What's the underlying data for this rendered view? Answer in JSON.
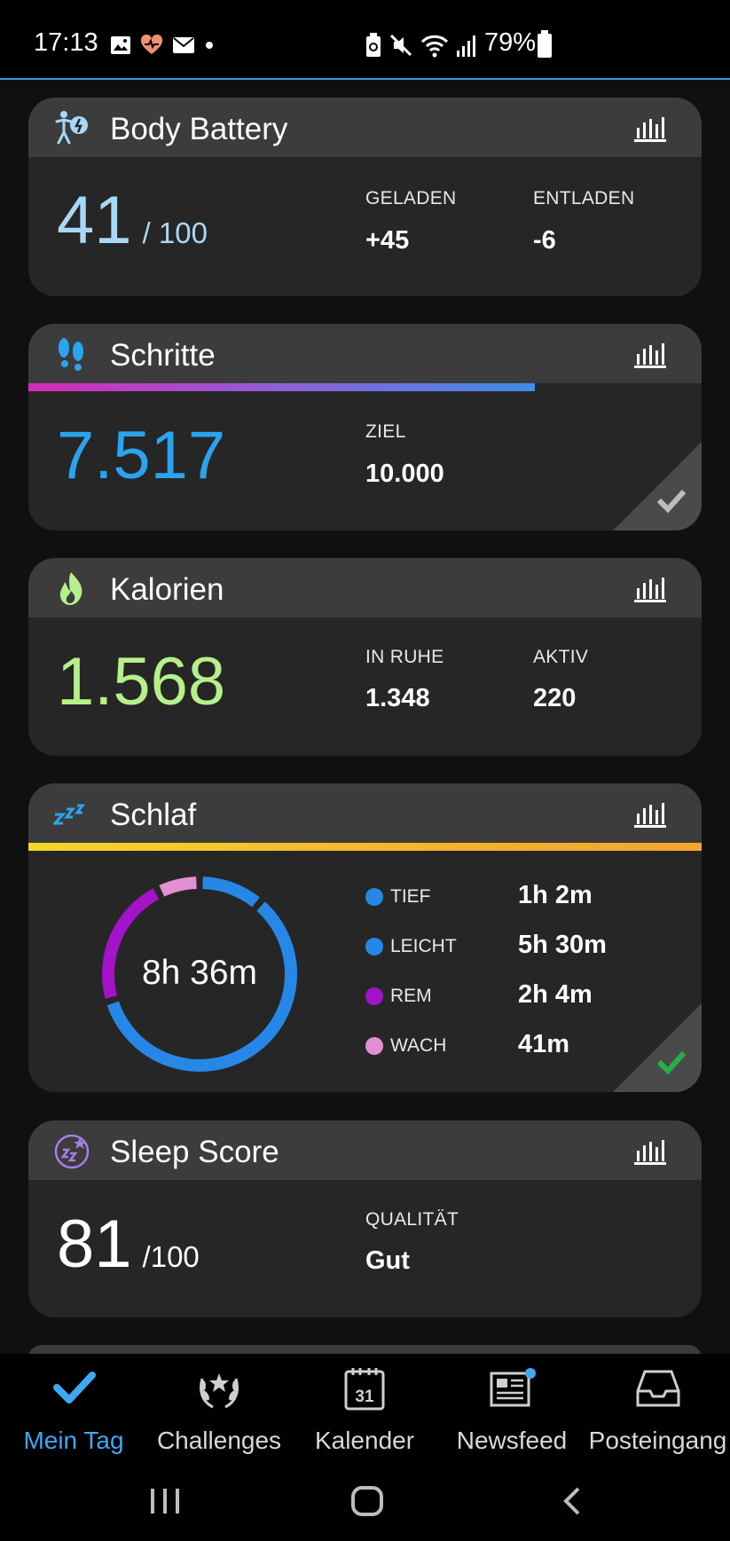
{
  "status_bar": {
    "time": "17:13",
    "battery": "79%"
  },
  "cards": {
    "body_battery": {
      "title": "Body Battery",
      "value": "41",
      "max": "/ 100",
      "charged_label": "GELADEN",
      "charged_value": "+45",
      "drained_label": "ENTLADEN",
      "drained_value": "-6",
      "color": "#a8d8f8"
    },
    "steps": {
      "title": "Schritte",
      "value": "7.517",
      "goal_label": "ZIEL",
      "goal_value": "10.000",
      "progress": 0.7517,
      "color": "#2aa4f0"
    },
    "calories": {
      "title": "Kalorien",
      "value": "1.568",
      "resting_label": "IN RUHE",
      "resting_value": "1.348",
      "active_label": "AKTIV",
      "active_value": "220",
      "color": "#b6f08a"
    },
    "sleep": {
      "title": "Schlaf",
      "total": "8h 36m",
      "stages": [
        {
          "name": "TIEF",
          "time": "1h 2m",
          "minutes": 62,
          "color": "#2787e6"
        },
        {
          "name": "LEICHT",
          "time": "5h 30m",
          "minutes": 330,
          "color": "#2787e6"
        },
        {
          "name": "REM",
          "time": "2h 4m",
          "minutes": 124,
          "color": "#a412c9"
        },
        {
          "name": "WACH",
          "time": "41m",
          "minutes": 41,
          "color": "#e38fd3"
        }
      ]
    },
    "sleep_score": {
      "title": "Sleep Score",
      "value": "81",
      "max": "/100",
      "quality_label": "QUALITÄT",
      "quality_value": "Gut"
    }
  },
  "bottom_nav": [
    {
      "label": "Mein Tag",
      "icon": "check-icon",
      "active": true
    },
    {
      "label": "Challenges",
      "icon": "laurel-icon",
      "active": false
    },
    {
      "label": "Kalender",
      "icon": "calendar-icon",
      "calendar_day": "31",
      "active": false
    },
    {
      "label": "Newsfeed",
      "icon": "newspaper-icon",
      "active": false
    },
    {
      "label": "Posteingang",
      "icon": "inbox-icon",
      "active": false
    }
  ]
}
